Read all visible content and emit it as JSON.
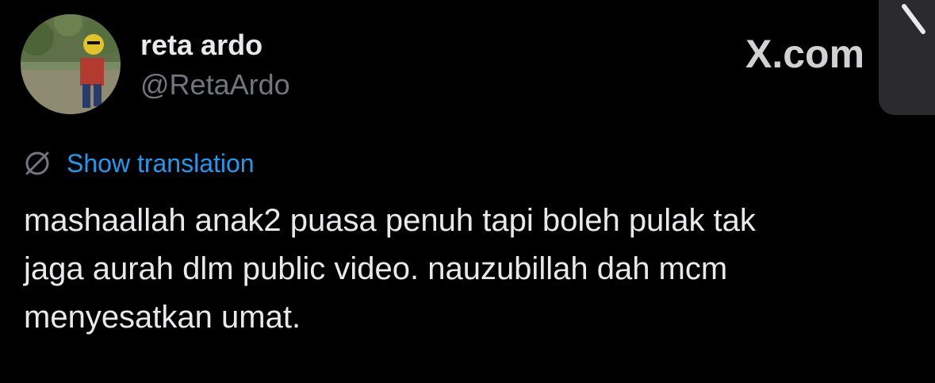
{
  "author": {
    "display_name": "reta ardo",
    "handle": "@RetaArdo"
  },
  "watermark": {
    "text": "X.com"
  },
  "translation": {
    "label": "Show translation",
    "icon": "globe-icon"
  },
  "tweet": {
    "lines": [
      "mashaallah anak2 puasa penuh tapi boleh pulak tak",
      "jaga aurah dlm public video. nauzubillah dah mcm",
      "menyesatkan umat."
    ]
  },
  "colors": {
    "background": "#000000",
    "text_primary": "#e7e9ea",
    "text_secondary": "#71767b",
    "link": "#1d9bf0",
    "overlay_panel": "#2b2b2d"
  }
}
